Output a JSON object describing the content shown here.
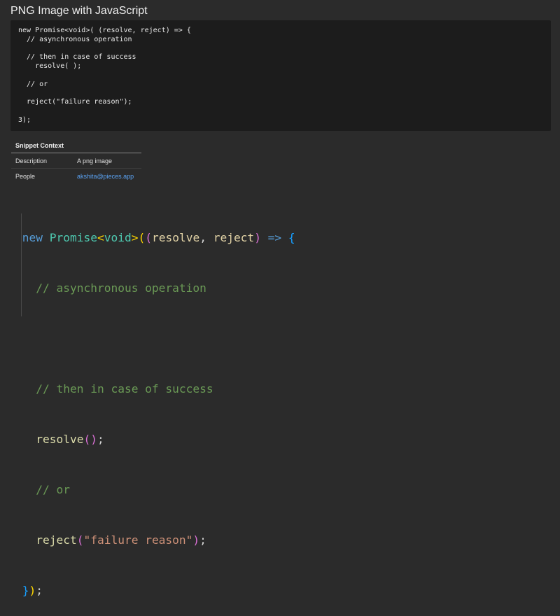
{
  "title": "PNG Image with JavaScript",
  "plain_code": {
    "lines": [
      "new Promise<void>( (resolve, reject) => {",
      "  // asynchronous operation",
      "",
      "  // then in case of success",
      "    resolve( );",
      "",
      "  // or",
      "",
      "  reject(\"failure reason\");",
      "",
      "3);"
    ]
  },
  "snippet_context": {
    "heading": "Snippet Context",
    "rows": [
      {
        "key": "Description",
        "value": "A png image"
      },
      {
        "key": "People",
        "value": "akshita@pieces.app"
      }
    ]
  },
  "highlighted_code": {
    "line1": {
      "kw": "new",
      "type": "Promise",
      "lt": "<",
      "generic": "void",
      "gt": ">",
      "open1": "(",
      "open2": "(",
      "param1": "resolve",
      "comma": ", ",
      "param2": "reject",
      "close2": ")",
      "arrow": " =>",
      "brace": " {"
    },
    "line2": {
      "comment": "// asynchronous operation"
    },
    "line4": {
      "comment": "// then in case of success"
    },
    "line5": {
      "fn": "resolve",
      "open": "(",
      "close": ")",
      "semi": ";"
    },
    "line6": {
      "comment": "// or"
    },
    "line7": {
      "fn": "reject",
      "open": "(",
      "str": "\"failure reason\"",
      "close": ")",
      "semi": ";"
    },
    "line8": {
      "brace": "}",
      "close": ")",
      "semi": ";"
    }
  },
  "colors": {
    "background": "#2b2b2b",
    "code_block_bg": "#1c1c1c",
    "keyword": "#569cd6",
    "type": "#4ec9b0",
    "comment": "#6a9955",
    "function": "#dcdcaa",
    "string": "#ce9178",
    "link": "#5aa2f2"
  }
}
